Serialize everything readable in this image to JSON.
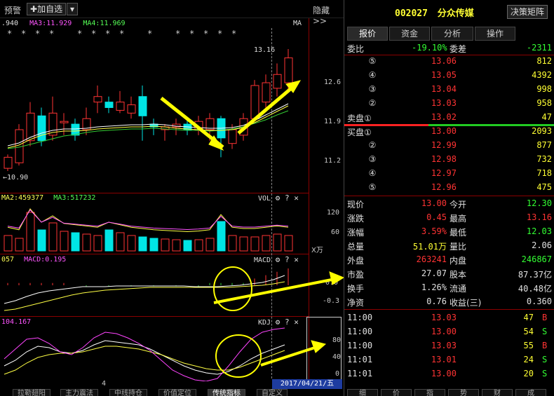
{
  "topbar": {
    "alert_label": "预警",
    "add_watch_label": "加自选",
    "hide_label": "隐藏>>"
  },
  "kline": {
    "ma_line": [
      ".940",
      "MA3:11.929",
      "MA4:11.969"
    ],
    "ma_label": "MA",
    "price_labels": [
      "12.6",
      "11.9",
      "11.2"
    ],
    "high_marker": "13.16",
    "low_marker": "10.90",
    "star": "*"
  },
  "volume": {
    "ma_line": [
      "MA2:459377",
      "MA3:517232"
    ],
    "title": "VOL",
    "axis": [
      "120",
      "60"
    ],
    "unit": "X万",
    "colors": {
      "up": "#ff3333",
      "down": "#00e5e5"
    }
  },
  "macd": {
    "ma_line": [
      "057",
      "MACD:0.195"
    ],
    "title": "MACD",
    "axis": [
      "0.0",
      "-0.3"
    ]
  },
  "kdj": {
    "ma_line": [
      "104.167"
    ],
    "title": "KDJ",
    "axis": [
      "80",
      "40",
      "0"
    ]
  },
  "footer": {
    "date": "2017/04/21/五",
    "tick": "4",
    "tabs": [
      "拉勒翅阳",
      "主力震法",
      "中线持仓",
      "价值定位",
      "传统指标",
      "自定义"
    ]
  },
  "quote": {
    "code": "002027",
    "name": "分众传媒",
    "decision_btn": "决策矩阵",
    "tabs": [
      "报价",
      "资金",
      "分析",
      "操作"
    ],
    "weibi_label": "委比",
    "weibi_value": "-19.10%",
    "weicha_label": "委差",
    "weicha_value": "-2311",
    "sell_label": "卖盘",
    "buy_label": "买盘",
    "sells": [
      {
        "lvl": "⑤",
        "price": "13.06",
        "vol": "812"
      },
      {
        "lvl": "④",
        "price": "13.05",
        "vol": "4392"
      },
      {
        "lvl": "③",
        "price": "13.04",
        "vol": "998"
      },
      {
        "lvl": "②",
        "price": "13.03",
        "vol": "958"
      },
      {
        "lvl": "①",
        "price": "13.02",
        "vol": "47"
      }
    ],
    "buys": [
      {
        "lvl": "①",
        "price": "13.00",
        "vol": "2093"
      },
      {
        "lvl": "②",
        "price": "12.99",
        "vol": "877"
      },
      {
        "lvl": "③",
        "price": "12.98",
        "vol": "732"
      },
      {
        "lvl": "④",
        "price": "12.97",
        "vol": "718"
      },
      {
        "lvl": "⑤",
        "price": "12.96",
        "vol": "475"
      }
    ],
    "stats": [
      {
        "l1": "现价",
        "v1": "13.00",
        "c1": "red",
        "l2": "今开",
        "v2": "12.30",
        "c2": "green"
      },
      {
        "l1": "涨跌",
        "v1": "0.45",
        "c1": "red",
        "l2": "最高",
        "v2": "13.16",
        "c2": "red"
      },
      {
        "l1": "涨幅",
        "v1": "3.59%",
        "c1": "red",
        "l2": "最低",
        "v2": "12.03",
        "c2": "green"
      },
      {
        "l1": "总量",
        "v1": "51.01万",
        "c1": "yellow",
        "l2": "量比",
        "v2": "2.06",
        "c2": "white"
      },
      {
        "l1": "外盘",
        "v1": "263241",
        "c1": "red",
        "l2": "内盘",
        "v2": "246867",
        "c2": "green"
      },
      {
        "l1": "市盈",
        "v1": "27.07",
        "c1": "white",
        "l2": "股本",
        "v2": "87.37亿",
        "c2": "white"
      },
      {
        "l1": "换手",
        "v1": "1.26%",
        "c1": "white",
        "l2": "流通",
        "v2": "40.48亿",
        "c2": "white"
      },
      {
        "l1": "净资",
        "v1": "0.76",
        "c1": "white",
        "l2": "收益(三)",
        "v2": "0.360",
        "c2": "white"
      }
    ],
    "trades": [
      {
        "time": "11:00",
        "price": "13.03",
        "vol": "47",
        "side": "B"
      },
      {
        "time": "11:00",
        "price": "13.00",
        "vol": "54",
        "side": "S"
      },
      {
        "time": "11:00",
        "price": "13.03",
        "vol": "55",
        "side": "B"
      },
      {
        "time": "11:01",
        "price": "13.01",
        "vol": "24",
        "side": "S"
      },
      {
        "time": "11:01",
        "price": "13.00",
        "vol": "20",
        "side": "S"
      }
    ],
    "bottom_tabs": [
      "细",
      "价",
      "指",
      "势",
      "财",
      "成"
    ]
  }
}
